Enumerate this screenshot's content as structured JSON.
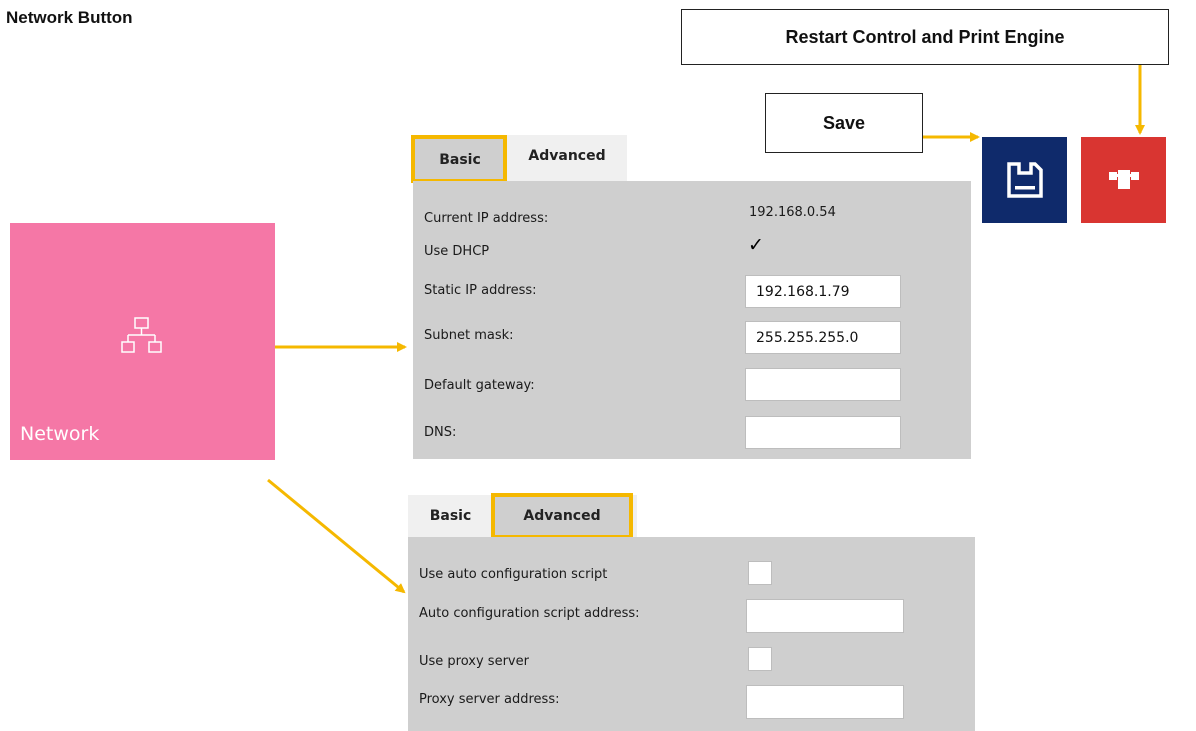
{
  "doc_title": "Network Button",
  "callouts": {
    "restart": "Restart Control and Print Engine",
    "save": "Save"
  },
  "network_tile": {
    "label": "Network",
    "icon": "network-topology-icon",
    "color": "#f577a6"
  },
  "buttons": {
    "save": {
      "icon": "floppy-disk-icon",
      "color": "#0f2a6b"
    },
    "restart": {
      "icon": "restart-print-engine-icon",
      "color": "#d93531"
    }
  },
  "highlight_color": "#f5b800",
  "basic_panel": {
    "tabs": [
      {
        "label": "Basic",
        "active": true,
        "highlighted": true
      },
      {
        "label": "Advanced",
        "active": false,
        "highlighted": false
      }
    ],
    "fields": {
      "current_ip": {
        "label": "Current IP address:",
        "value": "192.168.0.54"
      },
      "use_dhcp": {
        "label": "Use DHCP",
        "checked": true,
        "mark": "✓"
      },
      "static_ip": {
        "label": "Static IP address:",
        "value": "192.168.1.79"
      },
      "subnet_mask": {
        "label": "Subnet mask:",
        "value": "255.255.255.0"
      },
      "default_gateway": {
        "label": "Default gateway:",
        "value": ""
      },
      "dns": {
        "label": "DNS:",
        "value": ""
      }
    }
  },
  "advanced_panel": {
    "tabs": [
      {
        "label": "Basic",
        "active": false,
        "highlighted": false
      },
      {
        "label": "Advanced",
        "active": true,
        "highlighted": true
      }
    ],
    "fields": {
      "use_auto_config": {
        "label": "Use auto configuration script",
        "checked": false
      },
      "auto_config_address": {
        "label": "Auto configuration script address:",
        "value": ""
      },
      "use_proxy": {
        "label": "Use proxy server",
        "checked": false
      },
      "proxy_address": {
        "label": "Proxy server address:",
        "value": ""
      }
    }
  }
}
